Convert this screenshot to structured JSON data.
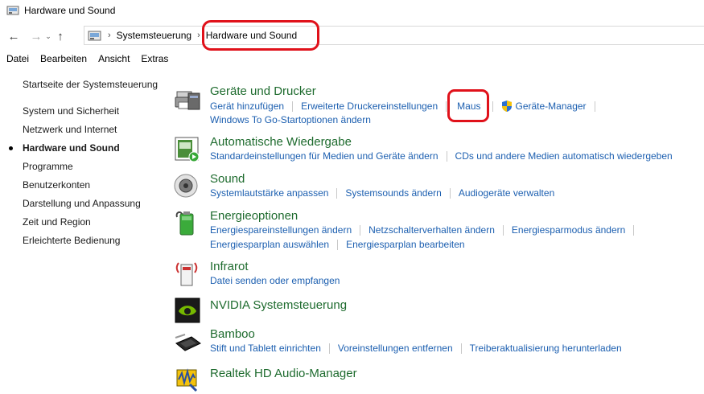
{
  "window": {
    "title": "Hardware und Sound",
    "icon": "control-panel-icon"
  },
  "nav": {
    "back_icon": "arrow-left-icon",
    "forward_icon": "arrow-right-icon",
    "recent_icon": "chevron-down-icon",
    "up_icon": "arrow-up-icon"
  },
  "breadcrumb": {
    "items": [
      "Systemsteuerung",
      "Hardware und Sound"
    ]
  },
  "menu": {
    "items": [
      "Datei",
      "Bearbeiten",
      "Ansicht",
      "Extras"
    ]
  },
  "sidebar": {
    "items": [
      "Startseite der Systemsteuerung",
      "System und Sicherheit",
      "Netzwerk und Internet",
      "Hardware und Sound",
      "Programme",
      "Benutzerkonten",
      "Darstellung und Anpassung",
      "Zeit und Region",
      "Erleichterte Bedienung"
    ],
    "current_index": 3
  },
  "categories": [
    {
      "heading": "Geräte und Drucker",
      "icon": "printer-icon",
      "rows": [
        [
          "Gerät hinzufügen",
          "Erweiterte Druckereinstellungen",
          "Maus",
          "Geräte-Manager"
        ],
        [
          "Windows To Go-Startoptionen ändern"
        ]
      ]
    },
    {
      "heading": "Automatische Wiedergabe",
      "icon": "autoplay-icon",
      "rows": [
        [
          "Standardeinstellungen für Medien und Geräte ändern",
          "CDs und andere Medien automatisch wiedergeben"
        ]
      ]
    },
    {
      "heading": "Sound",
      "icon": "speaker-icon",
      "rows": [
        [
          "Systemlautstärke anpassen",
          "Systemsounds ändern",
          "Audiogeräte verwalten"
        ]
      ]
    },
    {
      "heading": "Energieoptionen",
      "icon": "battery-icon",
      "rows": [
        [
          "Energiespareinstellungen ändern",
          "Netzschalterverhalten ändern",
          "Energiesparmodus ändern"
        ],
        [
          "Energiesparplan auswählen",
          "Energiesparplan bearbeiten"
        ]
      ]
    },
    {
      "heading": "Infrarot",
      "icon": "infrared-icon",
      "rows": [
        [
          "Datei senden oder empfangen"
        ]
      ]
    },
    {
      "heading": "NVIDIA Systemsteuerung",
      "icon": "nvidia-icon",
      "rows": []
    },
    {
      "heading": "Bamboo",
      "icon": "tablet-icon",
      "rows": [
        [
          "Stift und Tablett einrichten",
          "Voreinstellungen entfernen",
          "Treiberaktualisierung herunterladen"
        ]
      ]
    },
    {
      "heading": "Realtek HD Audio-Manager",
      "icon": "realtek-audio-icon",
      "rows": []
    }
  ],
  "colors": {
    "heading": "#1e6b2e",
    "link": "#1c5fb0",
    "highlight": "#e0111a"
  }
}
